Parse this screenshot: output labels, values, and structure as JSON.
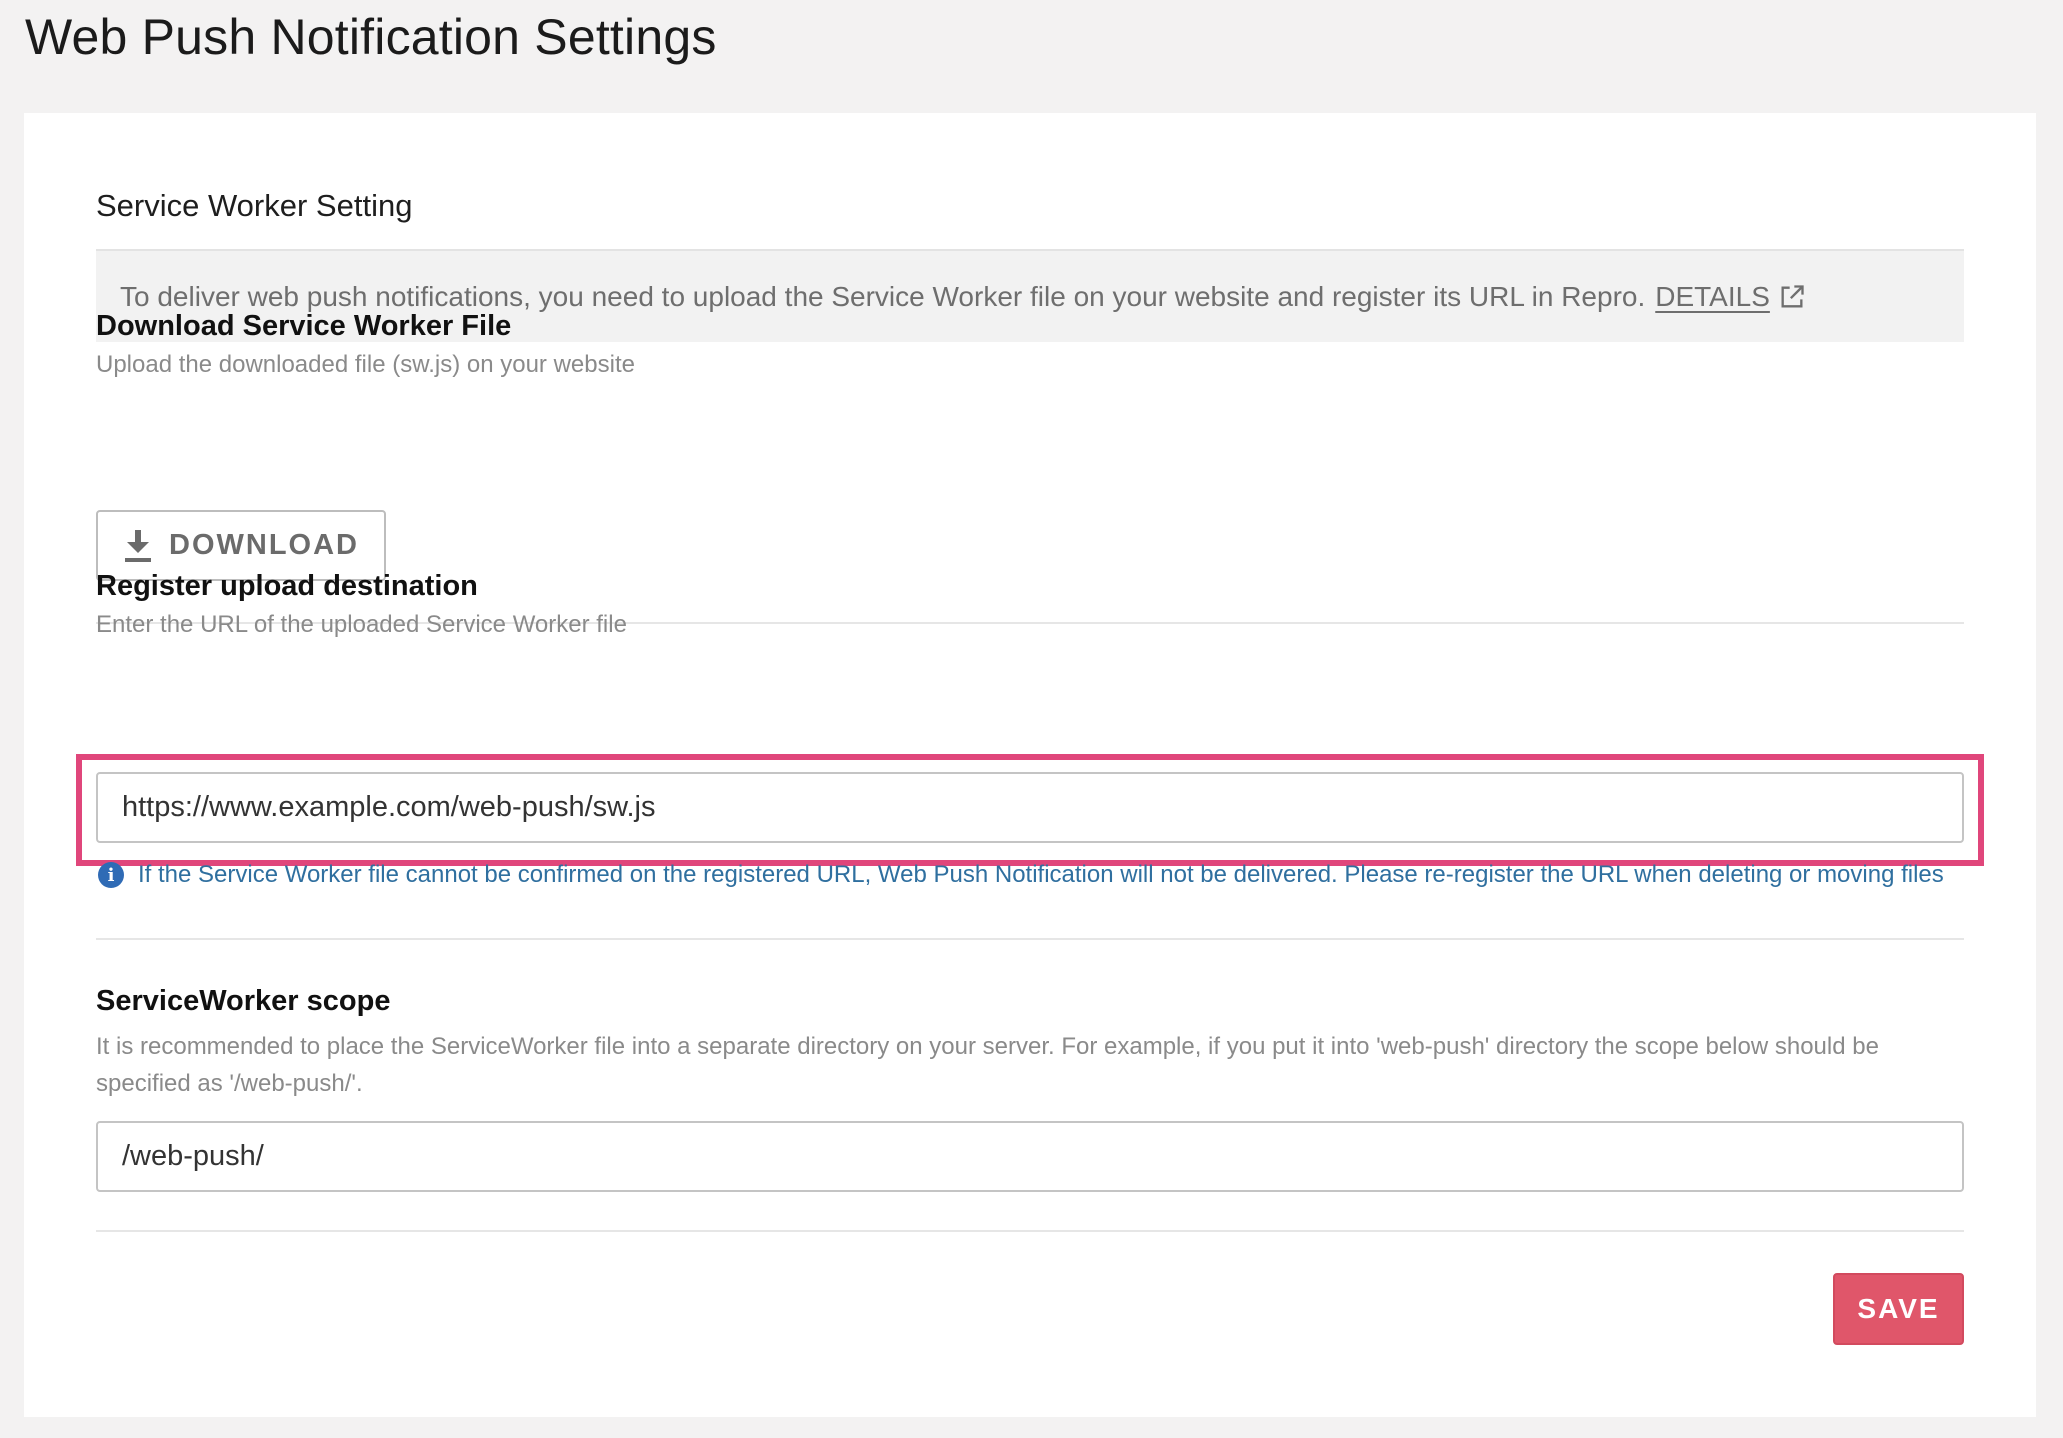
{
  "page": {
    "title": "Web Push Notification Settings"
  },
  "service_worker": {
    "heading": "Service Worker Setting",
    "info_text": "To deliver web push notifications, you need to upload the Service Worker file on your website and register its URL in Repro.",
    "details_link": "DETAILS",
    "details_icon": "external-link-icon"
  },
  "download": {
    "title": "Download Service Worker File",
    "description": "Upload the downloaded file (sw.js) on your website",
    "button_label": "DOWNLOAD",
    "button_icon": "download-icon"
  },
  "register": {
    "title": "Register upload destination",
    "description": "Enter the URL of the uploaded Service Worker file",
    "url_value": "https://www.example.com/web-push/sw.js",
    "notice_icon": "info-icon",
    "notice": "If the Service Worker file cannot be confirmed on the registered URL, Web Push Notification will not be delivered. Please re-register the URL when deleting or moving files"
  },
  "scope": {
    "title": "ServiceWorker scope",
    "description": "It is recommended to place the ServiceWorker file into a separate directory on your server. For example, if you put it into 'web-push' directory the scope below should be specified as '/web-push/'.",
    "value": "/web-push/"
  },
  "actions": {
    "save_label": "SAVE"
  },
  "colors": {
    "save_button": "#e0566a",
    "highlight_frame": "#e0467b",
    "notice_text": "#2f6f9f",
    "page_background": "#f3f2f2"
  }
}
